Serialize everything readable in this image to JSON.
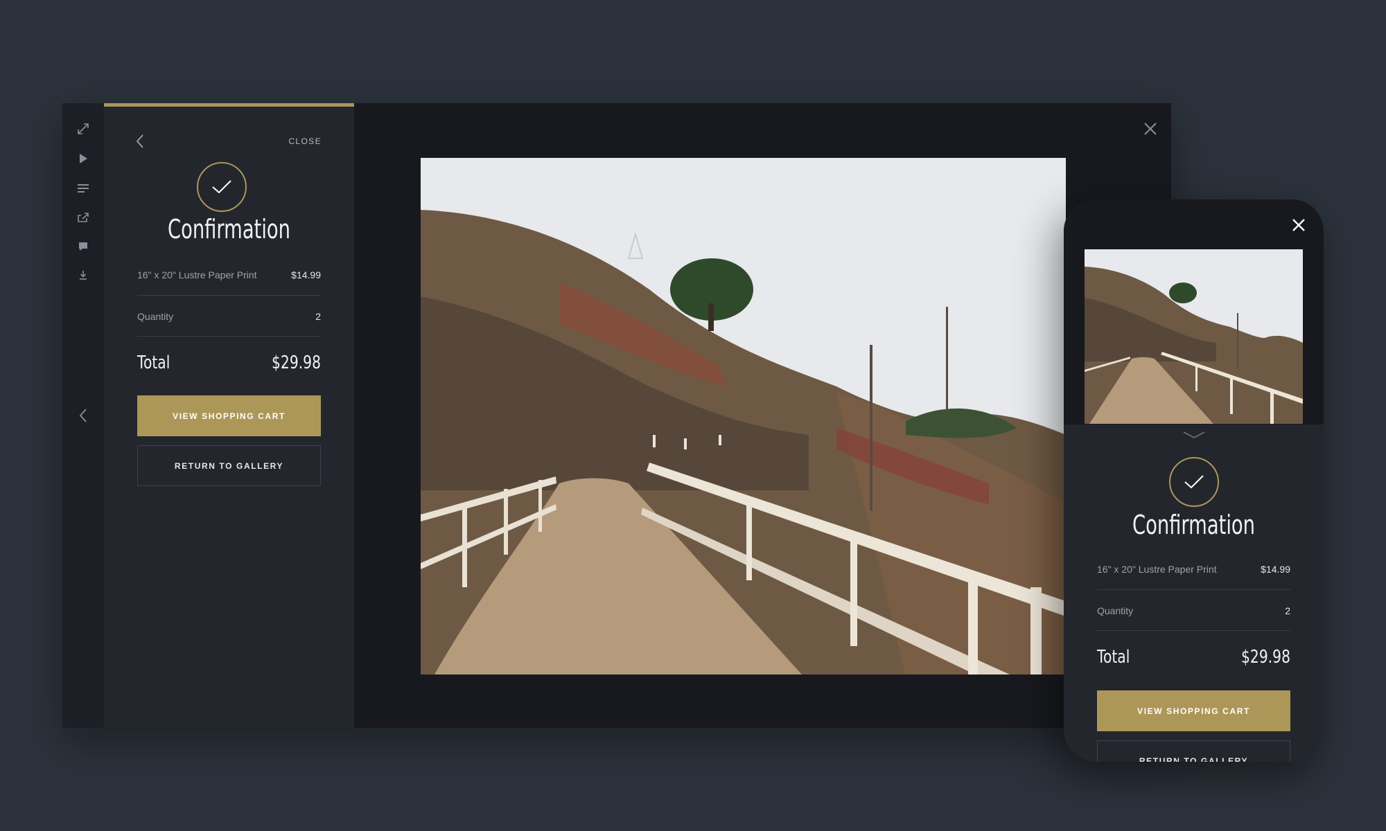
{
  "panel": {
    "close_label": "CLOSE",
    "confirmation_title": "Confirmation",
    "item_label": "16\" x  20\"  Lustre Paper Print",
    "item_price": "$14.99",
    "quantity_label": "Quantity",
    "quantity_value": "2",
    "total_label": "Total",
    "total_value": "$29.98",
    "view_cart_label": "VIEW SHOPPING CART",
    "return_gallery_label": "RETURN TO GALLERY"
  },
  "rail_icons": [
    "fullscreen-icon",
    "play-icon",
    "menu-icon",
    "share-icon",
    "comment-icon",
    "download-icon",
    "chevron-left-icon"
  ],
  "colors": {
    "accent": "#ad9758",
    "background": "#2c323b",
    "window": "#17191e",
    "panel": "#23262c"
  },
  "mobile": {
    "confirmation_title": "Confirmation",
    "item_label": "16\" x  20\"  Lustre Paper Print",
    "item_price": "$14.99",
    "quantity_label": "Quantity",
    "quantity_value": "2",
    "total_label": "Total",
    "total_value": "$29.98",
    "view_cart_label": "VIEW SHOPPING CART",
    "return_gallery_label": "RETURN TO GALLERY"
  }
}
